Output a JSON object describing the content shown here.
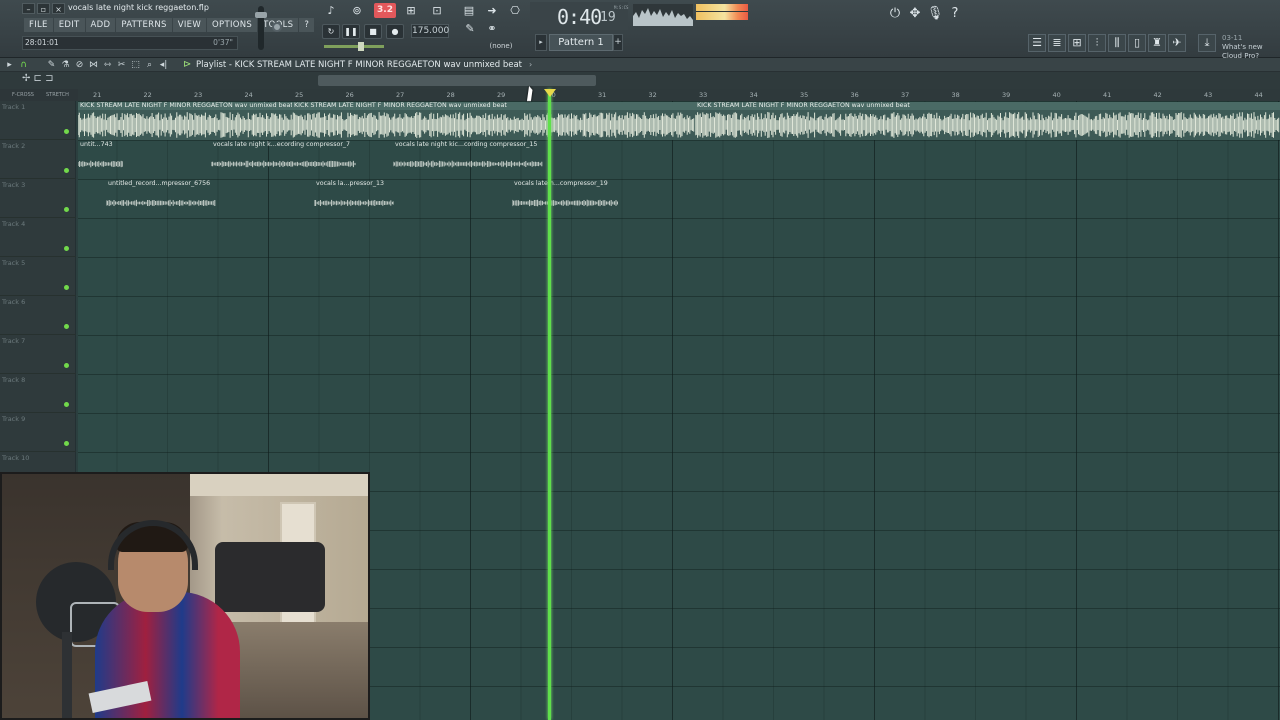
{
  "app": {
    "project_file": "vocals late night kick reggaeton.flp",
    "window_controls": [
      "–",
      "▫",
      "×"
    ]
  },
  "menu": [
    "FILE",
    "EDIT",
    "ADD",
    "PATTERNS",
    "VIEW",
    "OPTIONS",
    "TOOLS",
    "?"
  ],
  "hint": {
    "time": "28:01:01",
    "length": "0'37\""
  },
  "transport": {
    "pat_song": "3.2",
    "tempo": "175.000",
    "time_main": "0:40",
    "time_sub": "19",
    "time_label": "M:S:CS",
    "snap": "(none)"
  },
  "pattern": {
    "label": "Pattern 1",
    "prev": "▸",
    "add": "+"
  },
  "news": {
    "date": "03-11",
    "text": "What's new",
    "sub": "Cloud Pro?"
  },
  "playlist": {
    "title": "Playlist - KICK STREAM LATE NIGHT F MINOR REGGAETON wav unmixed beat",
    "chevron": "›",
    "head_labels": [
      "F-CROSS",
      "STRETCH"
    ]
  },
  "ruler": [
    "21",
    "22",
    "23",
    "24",
    "25",
    "26",
    "27",
    "28",
    "29",
    "30",
    "31",
    "32",
    "33",
    "34",
    "35",
    "36",
    "37",
    "38",
    "39",
    "40",
    "41",
    "42",
    "43",
    "44"
  ],
  "tracks": [
    "Track 1",
    "Track 2",
    "Track 3",
    "Track 4",
    "Track 5",
    "Track 6",
    "Track 7",
    "Track 8",
    "Track 9",
    "Track 10"
  ],
  "clips": {
    "beat": [
      "KICK STREAM LATE NIGHT F MINOR REGGAETON wav unmixed beat",
      "KICK STREAM LATE NIGHT F MINOR REGGAETON wav unmixed beat",
      "KICK STREAM LATE NIGHT F MINOR REGGAETON wav unmixed beat"
    ],
    "track2": [
      "untit...743",
      "vocals late night k...ecording compressor_7",
      "vocals late night kic...cording compressor_15"
    ],
    "track3": [
      "untitled_record...mpressor_6756",
      "vocals la...pressor_13",
      "vocals late n...compressor_19"
    ]
  },
  "colors": {
    "playhead": "#5fe04b",
    "pattern_song_active": "#e2585b",
    "grid_bg": "#2e4a47",
    "track_led": "#72d94b"
  },
  "icons": {
    "toolbar": [
      "metronome-icon",
      "record-icon",
      "step-icon",
      "blend-icon",
      "keyboard-icon",
      "arrow-icon",
      "loop-icon"
    ],
    "right": [
      "power-icon",
      "plugin-icon",
      "mic-icon",
      "help-icon"
    ],
    "windows": [
      "playlist-icon",
      "channel-rack-icon",
      "piano-roll-icon",
      "mixer-icon",
      "browser-icon",
      "plugin-database-icon",
      "tempo-icon",
      "cloud-icon",
      "download-icon"
    ]
  }
}
